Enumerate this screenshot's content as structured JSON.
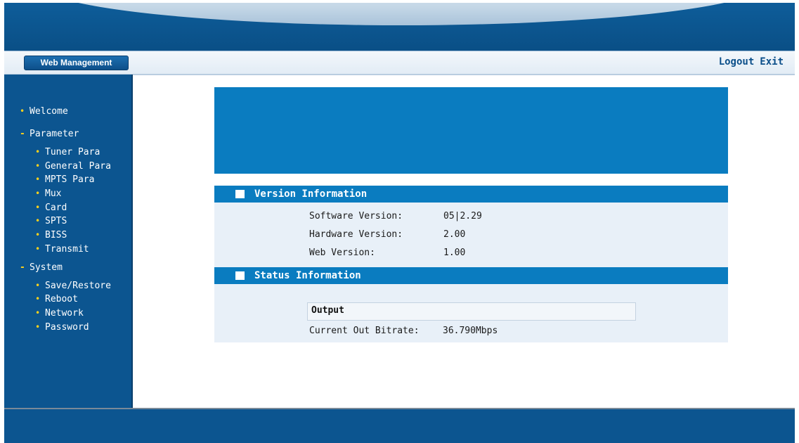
{
  "header": {
    "tab_label": "Web Management",
    "logout_label": "Logout",
    "exit_label": "Exit"
  },
  "sidebar": {
    "welcome": "Welcome",
    "parameter_group": "Parameter",
    "parameter_items": [
      "Tuner Para",
      "General Para",
      "MPTS Para",
      "Mux",
      "Card",
      "SPTS",
      "BISS",
      "Transmit"
    ],
    "system_group": "System",
    "system_items": [
      "Save/Restore",
      "Reboot",
      "Network",
      "Password"
    ]
  },
  "version_info": {
    "title": "Version Information",
    "software_label": "Software Version:",
    "software_value": "05|2.29",
    "hardware_label": "Hardware Version:",
    "hardware_value": "2.00",
    "web_label": "Web Version:",
    "web_value": "1.00"
  },
  "status_info": {
    "title": "Status Information",
    "output_heading": "Output",
    "bitrate_label": "Current Out Bitrate:",
    "bitrate_value": "36.790Mbps"
  },
  "colors": {
    "primary_blue": "#0c5590",
    "section_blue": "#0a7cc0",
    "bullet_yellow": "#ffd21a",
    "panel_bg": "#e8f0f8"
  }
}
